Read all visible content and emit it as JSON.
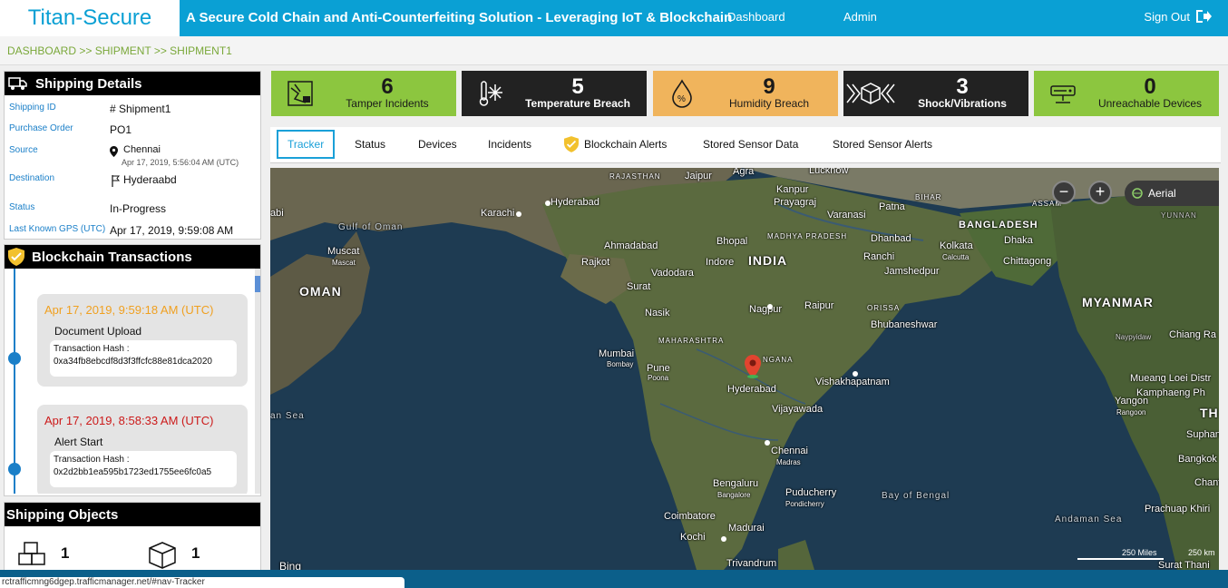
{
  "header": {
    "brand": "Titan-Secure",
    "tagline": "A Secure Cold Chain and Anti-Counterfeiting Solution - Leveraging IoT & Blockchain",
    "nav": [
      "Dashboard",
      "Admin"
    ],
    "signout": "Sign Out"
  },
  "breadcrumb": "DASHBOARD >> SHIPMENT >> SHIPMENT1",
  "shipping_details": {
    "title": "Shipping Details",
    "rows": [
      {
        "label": "Shipping ID",
        "value": "# Shipment1"
      },
      {
        "label": "Purchase Order",
        "value": "PO1"
      },
      {
        "label": "Source",
        "value": "Chennai",
        "sub": "Apr 17, 2019, 5:56:04 AM (UTC)"
      },
      {
        "label": "Destination",
        "value": "Hyderaabd"
      },
      {
        "label": "Status",
        "value": "In-Progress"
      },
      {
        "label": "Last Known GPS (UTC)",
        "value": "Apr 17, 2019, 9:59:08 AM"
      }
    ]
  },
  "blockchain": {
    "title": "Blockchain Transactions",
    "transactions": [
      {
        "date": "Apr 17, 2019, 9:59:18 AM (UTC)",
        "type": "Document Upload",
        "hash_label": "Transaction Hash :",
        "hash": "0xa34fb8ebcdf8d3f3ffcfc88e81dca2020",
        "color": "#f0a020"
      },
      {
        "date": "Apr 17, 2019, 8:58:33 AM (UTC)",
        "type": "Alert Start",
        "hash_label": "Transaction Hash :",
        "hash": "0x2d2bb1ea595b1723ed1755ee6fc0a5",
        "color": "#cc1a1a"
      }
    ]
  },
  "shipping_objects": {
    "title": "Shipping Objects",
    "items": [
      {
        "icon": "pallet-boxes-icon",
        "count": "1"
      },
      {
        "icon": "package-box-icon",
        "count": "1"
      }
    ]
  },
  "tiles": [
    {
      "icon": "tamper-icon",
      "value": "6",
      "label": "Tamper Incidents",
      "bg": "#8cc63f",
      "fg": "#1a1a1a"
    },
    {
      "icon": "snowflake-thermometer-icon",
      "value": "5",
      "label": "Temperature Breach",
      "bg": "#222222",
      "fg": "#ffffff"
    },
    {
      "icon": "humidity-drop-icon",
      "value": "9",
      "label": "Humidity Breach",
      "bg": "#f0b45c",
      "fg": "#1a1a1a"
    },
    {
      "icon": "shock-box-icon",
      "value": "3",
      "label": "Shock/Vibrations",
      "bg": "#222222",
      "fg": "#ffffff"
    },
    {
      "icon": "router-icon",
      "value": "0",
      "label": "Unreachable Devices",
      "bg": "#8cc63f",
      "fg": "#1a1a1a"
    }
  ],
  "tabs": [
    "Tracker",
    "Status",
    "Devices",
    "Incidents",
    "Blockchain Alerts",
    "Stored Sensor Data",
    "Stored Sensor Alerts"
  ],
  "map": {
    "map_type": "Aerial",
    "zoom_out": "−",
    "zoom_in": "+",
    "scale_1": "250 Miles",
    "scale_2": "250 km",
    "attribution": "Bing",
    "labels": {
      "india": "INDIA",
      "oman": "OMAN",
      "myanmar": "MYANMAR",
      "bangladesh": "BANGLADESH",
      "gulf_of_oman": "Gulf of Oman",
      "bay_of_bengal": "Bay of Bengal",
      "andaman_sea": "Andaman Sea",
      "arabian_sea": "an Sea",
      "rajasthan": "RAJASTHAN",
      "maharashtra": "MAHARASHTRA",
      "madhya_pradesh": "MADHYA PRADESH",
      "odisha": "ORISSA",
      "bihar": "BIHAR",
      "assam": "ASSAM",
      "yunnan": "YUNNAN",
      "telangana": "NGANA",
      "karachi": "Karachi",
      "muscat": "Muscat",
      "muscat_sub": "Mascat",
      "hyderabad_pk": "Hyderabad",
      "ahmadabad": "Ahmadabad",
      "rajkot": "Rajkot",
      "vadodara": "Vadodara",
      "surat": "Surat",
      "nasik": "Nasik",
      "mumbai": "Mumbai",
      "mumbai_sub": "Bombay",
      "pune": "Pune",
      "pune_sub": "Poona",
      "jaipur": "Jaipur",
      "agra": "Agra",
      "lucknow": "Lucknow",
      "kanpur": "Kanpur",
      "prayagraj": "Prayagraj",
      "varanasi": "Varanasi",
      "patna": "Patna",
      "bhopal": "Bhopal",
      "indore": "Indore",
      "nagpur": "Nagpur",
      "raipur": "Raipur",
      "dhanbad": "Dhanbad",
      "ranchi": "Ranchi",
      "jamshedpur": "Jamshedpur",
      "kolkata": "Kolkata",
      "kolkata_sub": "Calcutta",
      "dhaka": "Dhaka",
      "chittagong": "Chittagong",
      "bhubaneshwar": "Bhubaneshwar",
      "hyderabad": "Hyderabad",
      "vishakhapatnam": "Vishakhapatnam",
      "vijayawada": "Vijayawada",
      "chennai": "Chennai",
      "chennai_sub": "Madras",
      "bengaluru": "Bengaluru",
      "bengaluru_sub": "Bangalore",
      "puducherry": "Puducherry",
      "puducherry_sub": "Pondicherry",
      "coimbatore": "Coimbatore",
      "madurai": "Madurai",
      "kochi": "Kochi",
      "trivandrum": "Trivandrum",
      "naypyidaw": "Naypyidaw",
      "chiang_rai": "Chiang Ra",
      "mueang_loei": "Mueang Loei Distr",
      "kamphaeng": "Kamphaeng Ph",
      "yangon": "Yangon",
      "yangon_sub": "Rangoon",
      "th": "TH",
      "suphan": "Suphan B",
      "bangkok": "Bangkok",
      "chantha": "Chantha",
      "prachuap": "Prachuap Khiri",
      "surat_thani": "Surat Thani",
      "abi": "abi"
    }
  },
  "status_url": "rctrafficmng6dgep.trafficmanager.net/#nav-Tracker"
}
